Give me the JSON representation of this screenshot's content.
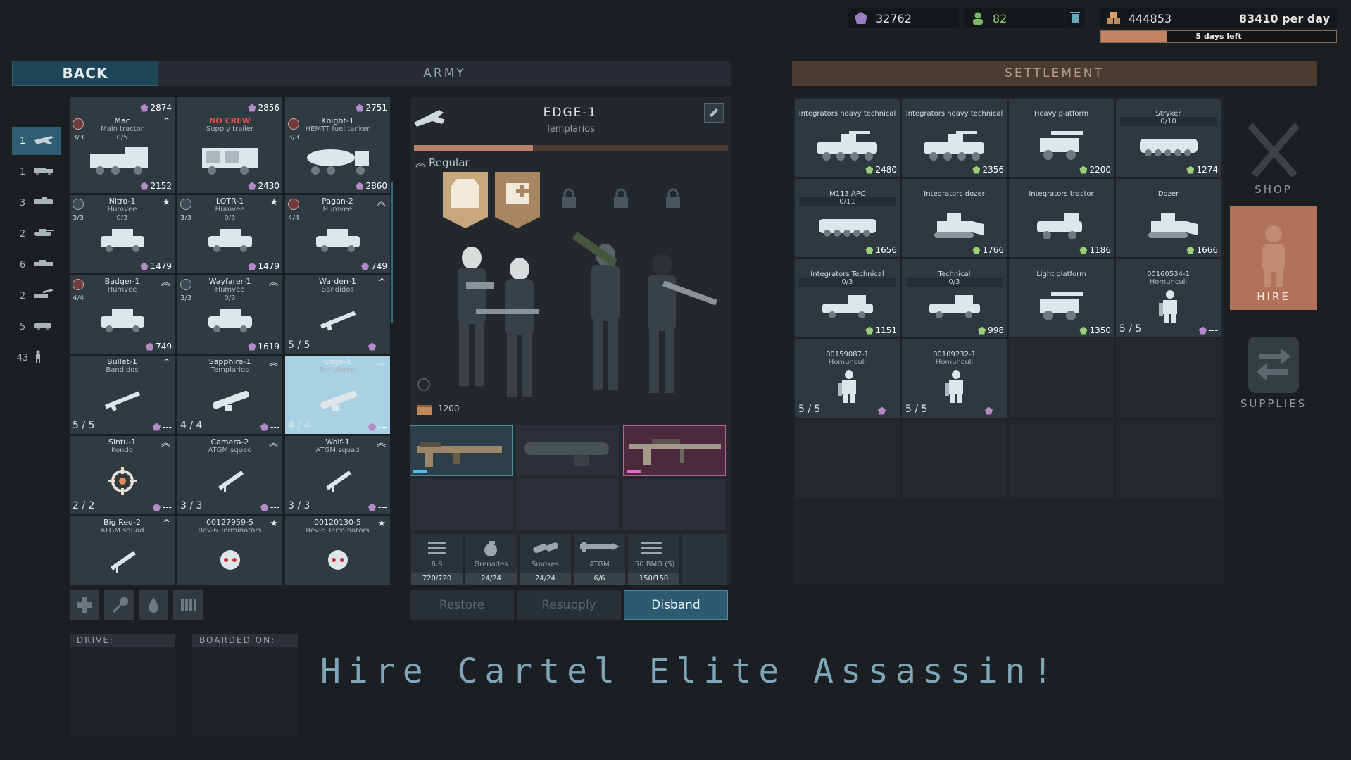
{
  "resources": {
    "gems": "32762",
    "people": "82",
    "supplies": "444853",
    "per_day": "83410 per day",
    "days_left": "5 days left",
    "days_progress": 0.28
  },
  "headers": {
    "back": "BACK",
    "army": "ARMY",
    "settlement": "SETTLEMENT"
  },
  "categories": [
    {
      "count": "1",
      "icon": "plane-icon"
    },
    {
      "count": "1",
      "icon": "truck-icon"
    },
    {
      "count": "3",
      "icon": "apc-icon"
    },
    {
      "count": "2",
      "icon": "tank-icon"
    },
    {
      "count": "6",
      "icon": "ifv-icon"
    },
    {
      "count": "2",
      "icon": "artillery-icon"
    },
    {
      "count": "5",
      "icon": "jeep-icon"
    },
    {
      "count": "43",
      "icon": "soldier-icon"
    }
  ],
  "army_cards": [
    {
      "name": "",
      "sub": "",
      "price": "2874",
      "icon": "apc-icon"
    },
    {
      "name": "",
      "sub": "",
      "price": "2856",
      "icon": "apc-icon"
    },
    {
      "name": "",
      "sub": "",
      "price": "2751",
      "icon": "apc-icon"
    },
    {
      "name": "Mac",
      "sub": "Main tractor",
      "crew": "3/3",
      "sub2": "0/5",
      "price": "2152",
      "icon": "truck-icon",
      "rank": "^"
    },
    {
      "name": "NO CREW",
      "sub": "Supply trailer",
      "price": "2430",
      "icon": "trailer-icon"
    },
    {
      "name": "Knight-1",
      "sub": "HEMTT fuel tanker",
      "crew": "3/3",
      "price": "2860",
      "icon": "tanker-icon"
    },
    {
      "name": "Nitro-1",
      "sub": "Humvee",
      "crew": "3/3",
      "sub2": "0/3",
      "price": "1479",
      "icon": "humvee-icon",
      "rank": "★"
    },
    {
      "name": "LOTR-1",
      "sub": "Humvee",
      "crew": "3/3",
      "sub2": "0/3",
      "price": "1479",
      "icon": "humvee-icon",
      "rank": "★"
    },
    {
      "name": "Pagan-2",
      "sub": "Humvee",
      "crew": "4/4",
      "price": "749",
      "icon": "humvee-icon",
      "rank": "︽"
    },
    {
      "name": "Badger-1",
      "sub": "Humvee",
      "crew": "4/4",
      "price": "749",
      "icon": "humvee-icon",
      "rank": "︽"
    },
    {
      "name": "Wayfarer-1",
      "sub": "Humvee",
      "crew": "3/3",
      "sub2": "0/3",
      "price": "1619",
      "icon": "humvee-icon",
      "rank": "︽"
    },
    {
      "name": "Warden-1",
      "sub": "Bandidos",
      "count": "5 / 5",
      "price": "---",
      "icon": "rifle-icon",
      "rank": "^"
    },
    {
      "name": "Bullet-1",
      "sub": "Bandidos",
      "count": "5 / 5",
      "price": "---",
      "icon": "rifle-icon",
      "rank": "^"
    },
    {
      "name": "Sapphire-1",
      "sub": "Templarios",
      "count": "4 / 4",
      "price": "---",
      "icon": "launcher-icon",
      "rank": "︽"
    },
    {
      "name": "Edge-1",
      "sub": "Templarios",
      "count": "4 / 4",
      "price": "---",
      "icon": "launcher-icon",
      "rank": "︽"
    },
    {
      "name": "Sintu-1",
      "sub": "Kondo",
      "count": "2 / 2",
      "price": "---",
      "icon": "crosshair-icon",
      "rank": "︽"
    },
    {
      "name": "Camera-2",
      "sub": "ATGM squad",
      "count": "3 / 3",
      "price": "---",
      "icon": "atgm-icon",
      "rank": "︽"
    },
    {
      "name": "Wolf-1",
      "sub": "ATGM squad",
      "count": "3 / 3",
      "price": "---",
      "icon": "atgm-icon",
      "rank": "︽"
    },
    {
      "name": "Big Red-2",
      "sub": "ATGM squad",
      "count": "",
      "price": "",
      "icon": "atgm-icon",
      "rank": "^"
    },
    {
      "name": "00127959-5",
      "sub": "Rev-6 Terminators",
      "count": "",
      "price": "",
      "icon": "skull-icon",
      "rank": "★"
    },
    {
      "name": "00120130-5",
      "sub": "Rev-6 Terminators",
      "count": "",
      "price": "",
      "icon": "skull-icon",
      "rank": "★"
    }
  ],
  "unit": {
    "name": "EDGE-1",
    "faction": "Templarios",
    "rank": "Regular",
    "supply": "1200",
    "weapons": [
      "rifle-weapon",
      "javelin-weapon",
      "sniper-weapon"
    ],
    "stats": [
      {
        "label": "6.8",
        "value": "720/720",
        "icon": "ammo-icon"
      },
      {
        "label": "Grenades",
        "value": "24/24",
        "icon": "grenade-icon"
      },
      {
        "label": "Smokes",
        "value": "24/24",
        "icon": "smoke-icon"
      },
      {
        "label": "ATGM",
        "value": "6/6",
        "icon": "missile-icon"
      },
      {
        "label": ".50 BMG (S)",
        "value": "150/150",
        "icon": "bullet-icon"
      }
    ],
    "buttons": {
      "restore": "Restore",
      "resupply": "Resupply",
      "disband": "Disband"
    }
  },
  "settlement_cards": [
    {
      "name": "Integrators heavy technical",
      "price": "2480",
      "icon": "technical-icon",
      "pent": "g"
    },
    {
      "name": "Integrators heavy technical",
      "price": "2356",
      "icon": "technical-icon",
      "pent": "g"
    },
    {
      "name": "Heavy platform",
      "price": "2200",
      "icon": "platform-icon",
      "pent": "g"
    },
    {
      "name": "Stryker",
      "bar": "0/10",
      "price": "1274",
      "icon": "apc-icon",
      "pent": "g"
    },
    {
      "name": "M113 APC",
      "bar": "0/11",
      "price": "1656",
      "icon": "apc-icon",
      "pent": "g"
    },
    {
      "name": "Integrators dozer",
      "price": "1766",
      "icon": "dozer-icon",
      "pent": "g"
    },
    {
      "name": "Integrators tractor",
      "price": "1186",
      "icon": "tractor-icon",
      "pent": "g"
    },
    {
      "name": "Dozer",
      "price": "1666",
      "icon": "dozer-icon",
      "pent": "g"
    },
    {
      "name": "Integrators Technical",
      "bar": "0/3",
      "price": "1151",
      "icon": "pickup-icon",
      "pent": "g"
    },
    {
      "name": "Technical",
      "bar": "0/3",
      "price": "998",
      "icon": "pickup-icon",
      "pent": "g"
    },
    {
      "name": "Light platform",
      "price": "1350",
      "icon": "platform-icon",
      "pent": "g"
    },
    {
      "name": "00160534-1",
      "sub": "Homunculi",
      "count": "5 / 5",
      "price": "---",
      "icon": "robot-icon",
      "pent": "p"
    },
    {
      "name": "00159087-1",
      "sub": "Homunculi",
      "count": "5 / 5",
      "price": "---",
      "icon": "robot-icon",
      "pent": "p"
    },
    {
      "name": "00109232-1",
      "sub": "Homunculi",
      "count": "5 / 5",
      "price": "---",
      "icon": "robot-icon",
      "pent": "p"
    }
  ],
  "right_menu": {
    "shop": "SHOP",
    "hire": "HIRE",
    "supplies": "SUPPLIES"
  },
  "drive": {
    "drive": "DRIVE:",
    "boarded": "BOARDED ON:"
  },
  "banner": "Hire Cartel Elite Assassin!",
  "colors": {
    "accent": "#2f5d72",
    "hire": "#b07258",
    "gem": "#b48ac8",
    "supply_gem": "#9bd07a"
  }
}
